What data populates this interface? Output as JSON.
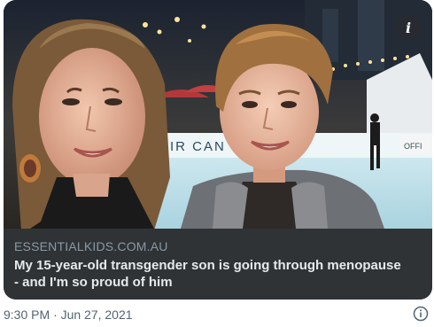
{
  "card": {
    "domain": "ESSENTIALKIDS.COM.AU",
    "headline": "My 15-year-old transgender son is going through menopause - and I'm so proud of him",
    "image_alt": "Mother and son smiling in front of an outdoor ice rink",
    "rink_sign_left": "AIR CAN",
    "rink_sign_right": "OFFI",
    "info_icon": "info-i-icon"
  },
  "tweet": {
    "timestamp": "9:30 PM · Jun 27, 2021",
    "info_icon": "info-circle-icon"
  },
  "colors": {
    "card_bg": "#2f3336",
    "domain_text": "#8b98a5",
    "headline_text": "#e7e9ea",
    "timestamp_text": "#536471"
  }
}
